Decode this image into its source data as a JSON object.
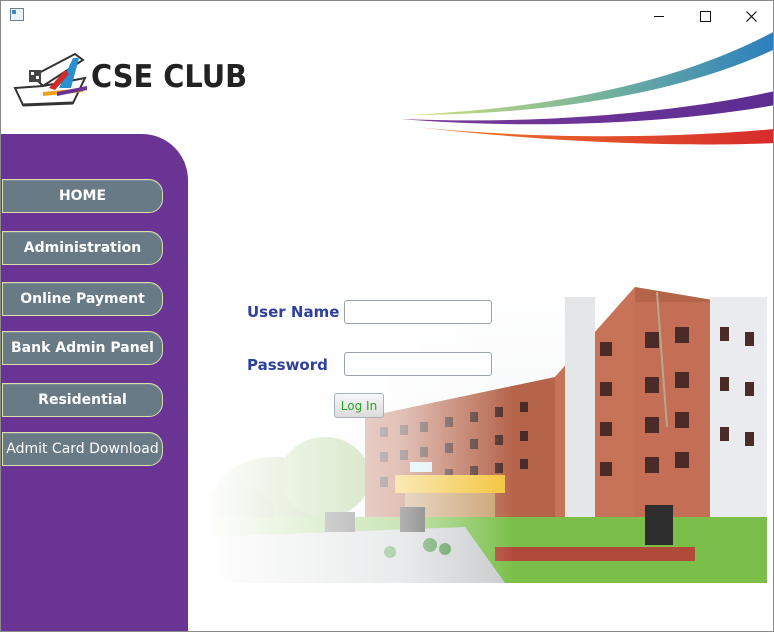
{
  "window": {
    "buttons": {
      "minimize_icon": "minimize-icon",
      "maximize_icon": "maximize-icon",
      "close_icon": "close-icon"
    }
  },
  "header": {
    "logo_text": "CSE CLUB",
    "swoosh_colors": [
      "#2a7fbf",
      "#5c2d91",
      "#d62b2b"
    ]
  },
  "sidebar": {
    "color": "#6a3494",
    "items": [
      {
        "label": "HOME"
      },
      {
        "label": "Administration"
      },
      {
        "label": "Online Payment"
      },
      {
        "label": "Bank Admin Panel"
      },
      {
        "label": "Residential"
      },
      {
        "label": "Admit Card Download"
      }
    ]
  },
  "login": {
    "username_label": "User Name",
    "username_value": "",
    "password_label": "Password",
    "password_value": "",
    "submit_label": "Log In"
  }
}
